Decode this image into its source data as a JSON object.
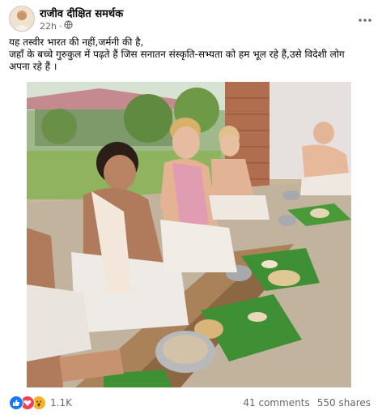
{
  "post": {
    "page_name": "राजीव दीक्षित समर्थक",
    "time": "22h",
    "privacy_icon": "globe-icon",
    "more_icon": "ellipsis-icon",
    "text_lines": [
      "यह तस्वीर भारत की नहीं,जर्मनी की है,",
      "जहाँ के बच्चे गुरुकुल में पढ़ते हैं जिस सनातन संस्कृति-सभ्यता को हम भूल रहे हैं,उसे विदेशी लोग",
      "अपना रहे हैं ।"
    ]
  },
  "photo": {
    "icon": "photo-children-eating-on-banana-leaves"
  },
  "footer": {
    "reaction_icons": [
      "like-icon",
      "love-icon",
      "wow-icon"
    ],
    "reaction_count": "1.1K",
    "comments": "41 comments",
    "shares": "550 shares"
  },
  "colors": {
    "like": "#1877f2",
    "love": "#f33e58",
    "wow": "#f7b125",
    "secondary_text": "#65676b"
  }
}
